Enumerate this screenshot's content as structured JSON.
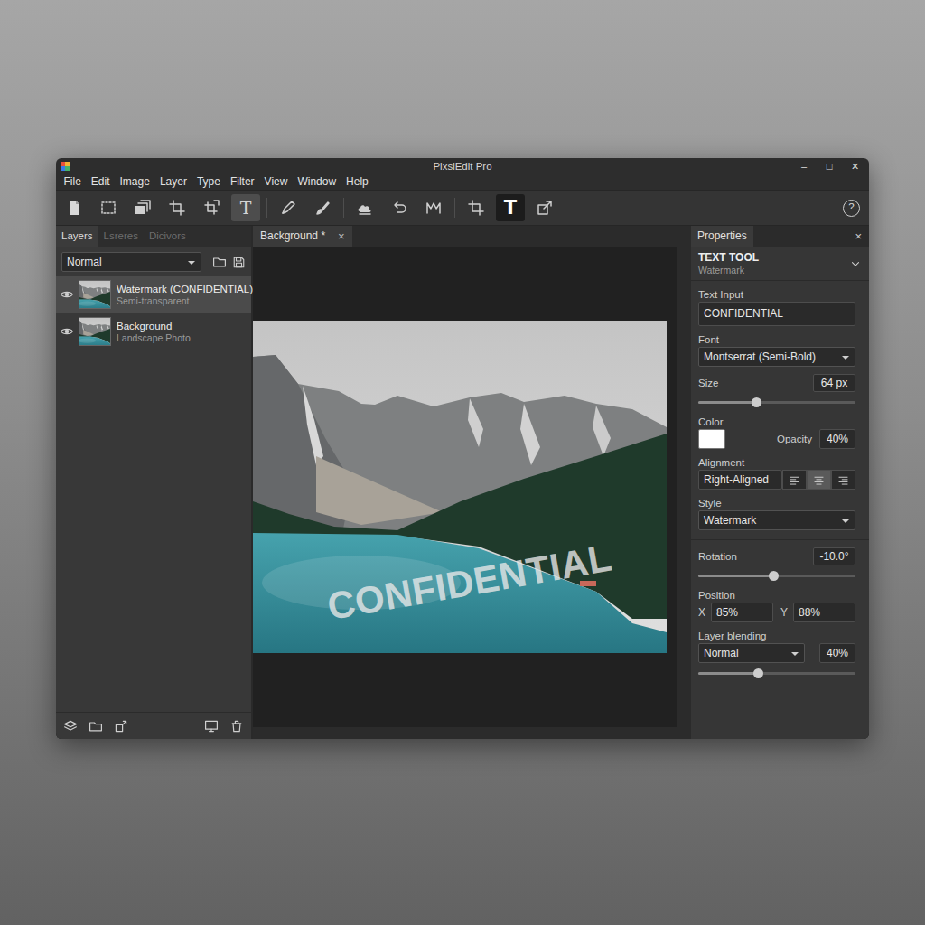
{
  "window": {
    "title": "PixslEdit Pro",
    "controls": [
      "–",
      "□",
      "✕"
    ]
  },
  "menu": [
    "File",
    "Edit",
    "Image",
    "Layer",
    "Type",
    "Filter",
    "View",
    "Window",
    "Help"
  ],
  "toolbar": {
    "groups": [
      [
        {
          "kind": "new",
          "selected": false
        },
        {
          "kind": "marquee",
          "selected": false
        },
        {
          "kind": "layers",
          "selected": false
        },
        {
          "kind": "crop",
          "selected": false
        },
        {
          "kind": "transform",
          "selected": false
        },
        {
          "kind": "text",
          "glyph": "T",
          "selected": true
        }
      ],
      [
        {
          "kind": "pen",
          "selected": false
        },
        {
          "kind": "brush",
          "selected": false
        }
      ],
      [
        {
          "kind": "stamp",
          "selected": false
        },
        {
          "kind": "undo",
          "selected": false
        },
        {
          "kind": "mask",
          "selected": false
        }
      ],
      [
        {
          "kind": "crop",
          "selected": false
        },
        {
          "kind": "text-large",
          "glyph": "T",
          "selected": true
        },
        {
          "kind": "export",
          "selected": false
        }
      ]
    ],
    "help": "?"
  },
  "layers_panel": {
    "tabs": [
      {
        "label": "Layers",
        "selected": true
      },
      {
        "label": "Lsreres",
        "selected": false
      },
      {
        "label": "Dicivors",
        "selected": false
      }
    ],
    "blend_mode": "Normal",
    "layers": [
      {
        "name": "Watermark (CONFIDENTIAL)",
        "detail": "Semi-transparent",
        "visible": true,
        "selected": true
      },
      {
        "name": "Background",
        "detail": "Landscape Photo",
        "visible": true,
        "selected": false
      }
    ]
  },
  "document": {
    "tab": "Background *",
    "close": "×",
    "watermark": "CONFIDENTIAL"
  },
  "properties": {
    "tab": "Properties",
    "close": "×",
    "tool": "TEXT TOOL",
    "preset": "Watermark",
    "text_input": {
      "label": "Text Input",
      "value": "CONFIDENTIAL"
    },
    "font": {
      "label": "Font",
      "value": "Montserrat (Semi-Bold)"
    },
    "size": {
      "label": "Size",
      "value": "64 px",
      "level": 0.37
    },
    "color": {
      "label": "Color",
      "color": "#ffffff"
    },
    "opacity": {
      "label": "Opacity",
      "value": "40%"
    },
    "alignment": {
      "label": "Alignment",
      "value": "Right-Aligned",
      "options": [
        {
          "kind": "left",
          "selected": false
        },
        {
          "kind": "center",
          "selected": true
        },
        {
          "kind": "right",
          "selected": false
        }
      ]
    },
    "style": {
      "label": "Style",
      "value": "Watermark"
    },
    "rotation": {
      "label": "Rotation",
      "value": "-10.0°",
      "level": 0.48
    },
    "position": {
      "label": "Position",
      "x_label": "X",
      "x": "85%",
      "y_label": "Y",
      "y": "88%"
    },
    "blending": {
      "label": "Layer blending",
      "mode": "Normal",
      "value": "40%",
      "level": 0.385
    }
  }
}
